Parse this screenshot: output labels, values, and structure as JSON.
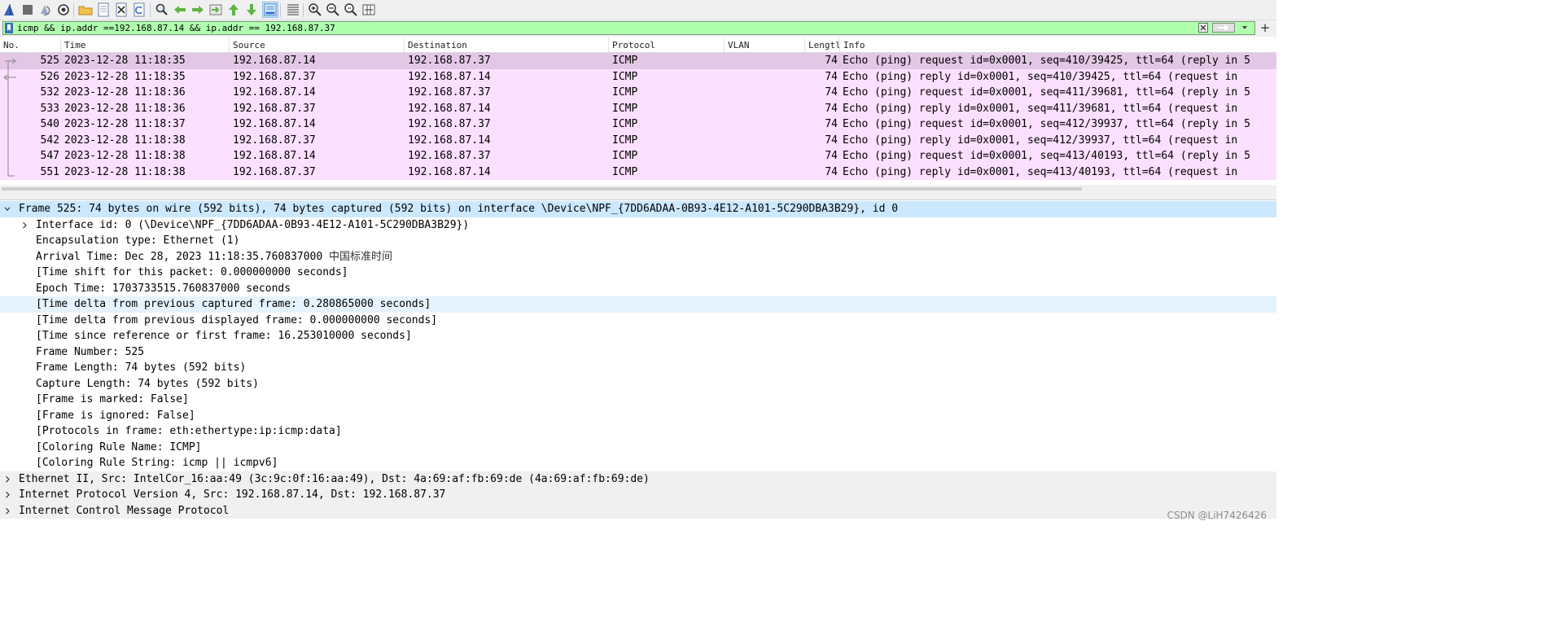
{
  "toolbar": {
    "buttons": [
      {
        "name": "start-capture-icon",
        "icon": "shark-fin-icon"
      },
      {
        "name": "stop-capture-icon",
        "icon": "stop-icon"
      },
      {
        "name": "restart-capture-icon",
        "icon": "restart-icon"
      },
      {
        "name": "capture-options-icon",
        "icon": "gear-icon"
      },
      {
        "name": "open-file-icon",
        "icon": "folder-icon"
      },
      {
        "name": "save-file-icon",
        "icon": "save-icon"
      },
      {
        "name": "close-file-icon",
        "icon": "close-icon"
      },
      {
        "name": "reload-file-icon",
        "icon": "reload-icon"
      },
      {
        "name": "find-packet-icon",
        "icon": "search-icon"
      },
      {
        "name": "go-back-icon",
        "icon": "arrow-left-icon"
      },
      {
        "name": "go-forward-icon",
        "icon": "arrow-right-icon"
      },
      {
        "name": "go-to-packet-icon",
        "icon": "goto-icon"
      },
      {
        "name": "go-first-icon",
        "icon": "arrow-up-icon"
      },
      {
        "name": "go-last-icon",
        "icon": "arrow-down-icon"
      },
      {
        "name": "auto-scroll-icon",
        "icon": "autoscroll-icon"
      },
      {
        "name": "colorize-icon",
        "icon": "colorize-icon"
      },
      {
        "name": "zoom-in-icon",
        "icon": "zoom-in-icon"
      },
      {
        "name": "zoom-out-icon",
        "icon": "zoom-out-icon"
      },
      {
        "name": "zoom-reset-icon",
        "icon": "zoom-reset-icon"
      },
      {
        "name": "resize-columns-icon",
        "icon": "resize-columns-icon"
      }
    ]
  },
  "filter": {
    "value": "icmp && ip.addr ==192.168.87.14 && ip.addr == 192.168.87.37",
    "plus": "+"
  },
  "columns": [
    "No.",
    "Time",
    "Source",
    "Destination",
    "Protocol",
    "VLAN",
    "Lengtl",
    "Info"
  ],
  "packets": [
    {
      "no": "525",
      "time": "2023-12-28 11:18:35",
      "src": "192.168.87.14",
      "dst": "192.168.87.37",
      "proto": "ICMP",
      "vlan": "",
      "len": "74",
      "info": "Echo (ping) request  id=0x0001, seq=410/39425, ttl=64 (reply in 5",
      "rel": "request",
      "selected": true
    },
    {
      "no": "526",
      "time": "2023-12-28 11:18:35",
      "src": "192.168.87.37",
      "dst": "192.168.87.14",
      "proto": "ICMP",
      "vlan": "",
      "len": "74",
      "info": "Echo (ping) reply    id=0x0001, seq=410/39425, ttl=64 (request in",
      "rel": "reply",
      "selected": false
    },
    {
      "no": "532",
      "time": "2023-12-28 11:18:36",
      "src": "192.168.87.14",
      "dst": "192.168.87.37",
      "proto": "ICMP",
      "vlan": "",
      "len": "74",
      "info": "Echo (ping) request  id=0x0001, seq=411/39681, ttl=64 (reply in 5",
      "rel": "line",
      "selected": false
    },
    {
      "no": "533",
      "time": "2023-12-28 11:18:36",
      "src": "192.168.87.37",
      "dst": "192.168.87.14",
      "proto": "ICMP",
      "vlan": "",
      "len": "74",
      "info": "Echo (ping) reply    id=0x0001, seq=411/39681, ttl=64 (request in",
      "rel": "line",
      "selected": false
    },
    {
      "no": "540",
      "time": "2023-12-28 11:18:37",
      "src": "192.168.87.14",
      "dst": "192.168.87.37",
      "proto": "ICMP",
      "vlan": "",
      "len": "74",
      "info": "Echo (ping) request  id=0x0001, seq=412/39937, ttl=64 (reply in 5",
      "rel": "line",
      "selected": false
    },
    {
      "no": "542",
      "time": "2023-12-28 11:18:38",
      "src": "192.168.87.37",
      "dst": "192.168.87.14",
      "proto": "ICMP",
      "vlan": "",
      "len": "74",
      "info": "Echo (ping) reply    id=0x0001, seq=412/39937, ttl=64 (request in",
      "rel": "line",
      "selected": false
    },
    {
      "no": "547",
      "time": "2023-12-28 11:18:38",
      "src": "192.168.87.14",
      "dst": "192.168.87.37",
      "proto": "ICMP",
      "vlan": "",
      "len": "74",
      "info": "Echo (ping) request  id=0x0001, seq=413/40193, ttl=64 (reply in 5",
      "rel": "line",
      "selected": false
    },
    {
      "no": "551",
      "time": "2023-12-28 11:18:38",
      "src": "192.168.87.37",
      "dst": "192.168.87.14",
      "proto": "ICMP",
      "vlan": "",
      "len": "74",
      "info": "Echo (ping) reply    id=0x0001, seq=413/40193, ttl=64 (request in",
      "rel": "end",
      "selected": false
    }
  ],
  "details": [
    {
      "text": "Frame 525: 74 bytes on wire (592 bits), 74 bytes captured (592 bits) on interface \\Device\\NPF_{7DD6ADAA-0B93-4E12-A101-5C290DBA3B29}, id 0",
      "level": 0,
      "arrow": "down",
      "style": "sel"
    },
    {
      "text": "Interface id: 0 (\\Device\\NPF_{7DD6ADAA-0B93-4E12-A101-5C290DBA3B29})",
      "level": 1,
      "arrow": "right",
      "style": ""
    },
    {
      "text": "Encapsulation type: Ethernet (1)",
      "level": 1,
      "arrow": "",
      "style": ""
    },
    {
      "text": "Arrival Time: Dec 28, 2023 11:18:35.760837000 ",
      "suffix": "中国标准时间",
      "level": 1,
      "arrow": "",
      "style": ""
    },
    {
      "text": "[Time shift for this packet: 0.000000000 seconds]",
      "level": 1,
      "arrow": "",
      "style": ""
    },
    {
      "text": "Epoch Time: 1703733515.760837000 seconds",
      "level": 1,
      "arrow": "",
      "style": ""
    },
    {
      "text": "[Time delta from previous captured frame: 0.280865000 seconds]",
      "level": 1,
      "arrow": "",
      "style": "hl"
    },
    {
      "text": "[Time delta from previous displayed frame: 0.000000000 seconds]",
      "level": 1,
      "arrow": "",
      "style": ""
    },
    {
      "text": "[Time since reference or first frame: 16.253010000 seconds]",
      "level": 1,
      "arrow": "",
      "style": ""
    },
    {
      "text": "Frame Number: 525",
      "level": 1,
      "arrow": "",
      "style": ""
    },
    {
      "text": "Frame Length: 74 bytes (592 bits)",
      "level": 1,
      "arrow": "",
      "style": ""
    },
    {
      "text": "Capture Length: 74 bytes (592 bits)",
      "level": 1,
      "arrow": "",
      "style": ""
    },
    {
      "text": "[Frame is marked: False]",
      "level": 1,
      "arrow": "",
      "style": ""
    },
    {
      "text": "[Frame is ignored: False]",
      "level": 1,
      "arrow": "",
      "style": ""
    },
    {
      "text": "[Protocols in frame: eth:ethertype:ip:icmp:data]",
      "level": 1,
      "arrow": "",
      "style": ""
    },
    {
      "text": "[Coloring Rule Name: ICMP]",
      "level": 1,
      "arrow": "",
      "style": ""
    },
    {
      "text": "[Coloring Rule String: icmp || icmpv6]",
      "level": 1,
      "arrow": "",
      "style": ""
    },
    {
      "text": "Ethernet II, Src: IntelCor_16:aa:49 (3c:9c:0f:16:aa:49), Dst: 4a:69:af:fb:69:de (4a:69:af:fb:69:de)",
      "level": 0,
      "arrow": "right",
      "style": "top"
    },
    {
      "text": "Internet Protocol Version 4, Src: 192.168.87.14, Dst: 192.168.87.37",
      "level": 0,
      "arrow": "right",
      "style": "top"
    },
    {
      "text": "Internet Control Message Protocol",
      "level": 0,
      "arrow": "right",
      "style": "top"
    }
  ],
  "watermark": "CSDN @LiH7426426",
  "colors": {
    "filter_valid": "#afffaf",
    "row_icmp": "#fce0ff",
    "row_selected": "#e3c8e6",
    "detail_selected": "#cce8ff"
  }
}
